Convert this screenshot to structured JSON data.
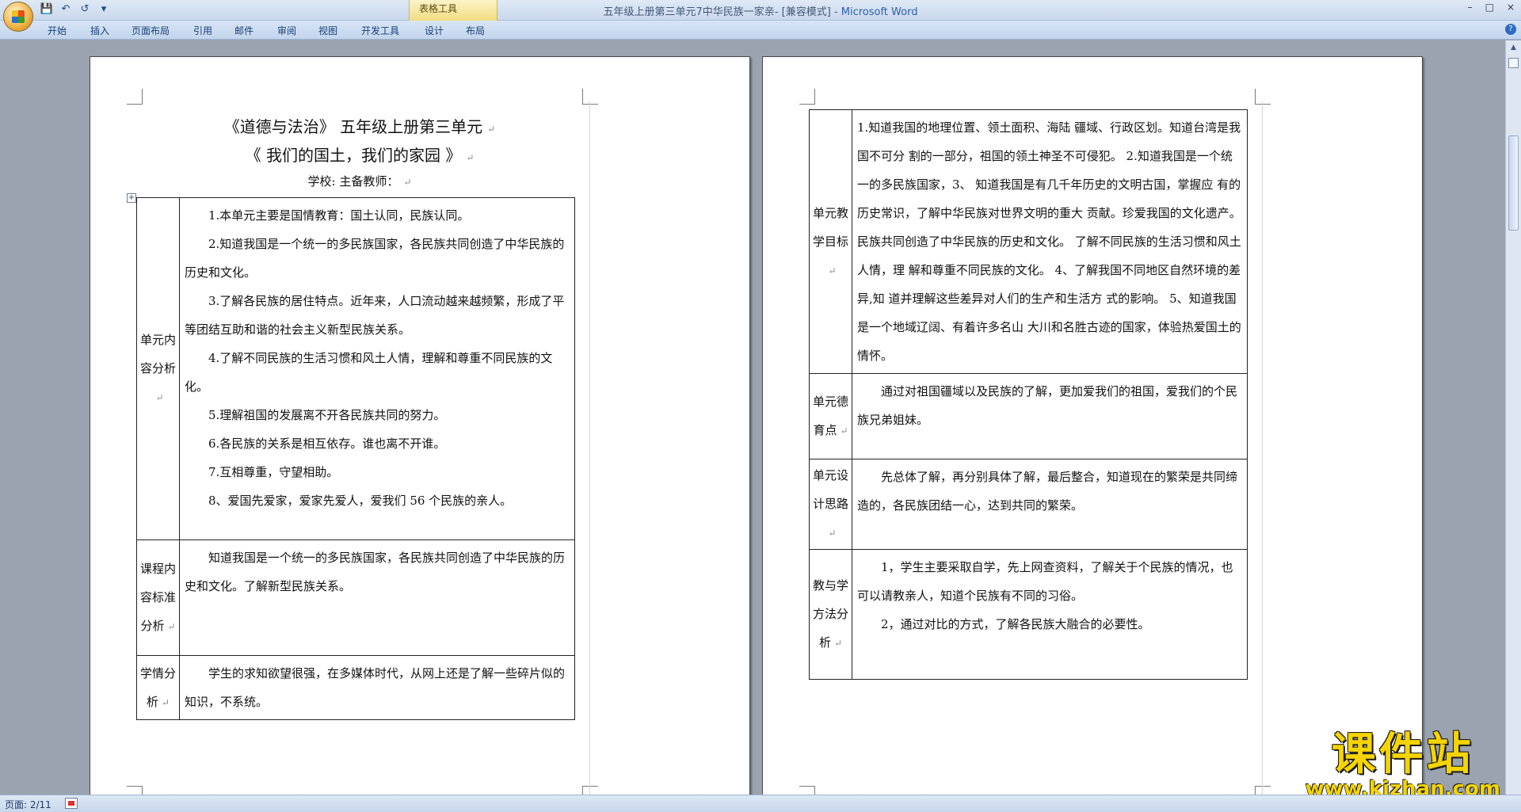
{
  "window": {
    "title": "五年级上册第三单元7中华民族一家亲- [兼容模式] - ",
    "app": "Microsoft Word",
    "context_tab": "表格工具",
    "controls": [
      "–",
      "□",
      "×"
    ]
  },
  "quick_access": {
    "icons": [
      "save-icon",
      "undo-icon",
      "redo-icon",
      "customize-icon"
    ]
  },
  "ribbon": {
    "tabs": [
      "开始",
      "插入",
      "页面布局",
      "引用",
      "邮件",
      "审阅",
      "视图",
      "开发工具",
      "设计",
      "布局"
    ]
  },
  "left_page": {
    "title_line1": "《道德与法治》 五年级上册第三单元",
    "title_line2": "《 我们的国土，我们的家园 》",
    "title_line3": "学校:              主备教师：",
    "mark": "↵",
    "rows": [
      {
        "label": "单元内容分析",
        "paragraphs": [
          "1.本单元主要是国情教育：国土认同，民族认同。",
          "2.知道我国是一个统一的多民族国家，各民族共同创造了中华民族的历史和文化。",
          "3.了解各民族的居住特点。近年来，人口流动越来越频繁，形成了平等团结互助和谐的社会主义新型民族关系。",
          "4.了解不同民族的生活习惯和风土人情，理解和尊重不同民族的文化。",
          "5.理解祖国的发展离不开各民族共同的努力。",
          "6.各民族的关系是相互依存。谁也离不开谁。",
          "7.互相尊重，守望相助。",
          "8、爱国先爱家，爱家先爱人，爱我们 56 个民族的亲人。",
          ""
        ]
      },
      {
        "label": "课程内容标准分析",
        "paragraphs": [
          "知道我国是一个统一的多民族国家，各民族共同创造了中华民族的历史和文化。了解新型民族关系。",
          ""
        ]
      },
      {
        "label": "学情分析",
        "paragraphs": [
          "学生的求知欲望很强，在多媒体时代，从网上还是了解一些碎片似的知识，不系统。"
        ]
      }
    ]
  },
  "right_page": {
    "rows": [
      {
        "label": "单元教学目标",
        "paragraphs": [
          "1.知道我国的地理位置、领土面积、海陆 疆域、行政区划。知道台湾是我国不可分 割的一部分，祖国的领土神圣不可侵犯。 2.知道我国是一个统一的多民族国家，3、 知道我国是有几千年历史的文明古国，掌握应 有的历史常识，了解中华民族对世界文明的重大 贡献。珍爱我国的文化遗产。 民族共同创造了中华民族的历史和文化。 了解不同民族的生活习惯和风土人情，理 解和尊重不同民族的文化。 4、了解我国不同地区自然环境的差异,知 道并理解这些差异对人们的生产和生活方 式的影响。 5、知道我国是一个地域辽阔、有着许多名山 大川和名胜古迹的国家，体验热爱国土的情怀。"
        ]
      },
      {
        "label": "单元德育点",
        "paragraphs": [
          "通过对祖国疆域以及民族的了解，更加爱我们的祖国，爱我们的个民族兄弟姐妹。"
        ]
      },
      {
        "label": "单元设计思路",
        "paragraphs": [
          "先总体了解，再分别具体了解，最后整合，知道现在的繁荣是共同缔造的，各民族团结一心，达到共同的繁荣。"
        ]
      },
      {
        "label": "教与学方法分析",
        "paragraphs": [
          "1，学生主要采取自学，先上网查资料，了解关于个民族的情况，也可以请教亲人，知道个民族有不同的习俗。",
          "2，通过对比的方式，了解各民族大融合的必要性。"
        ]
      }
    ]
  },
  "status": {
    "page": "页面: 2/11"
  },
  "watermark": {
    "cn": "课件站",
    "url": "www.kjzhan.com"
  }
}
